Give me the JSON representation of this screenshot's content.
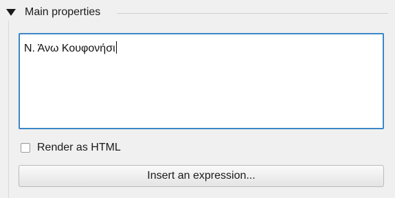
{
  "group": {
    "title": "Main properties"
  },
  "label_text": {
    "value": "Ν. Άνω Κουφονήσι"
  },
  "render_html": {
    "label": "Render as HTML",
    "checked": false
  },
  "insert_expression": {
    "label": "Insert an expression..."
  }
}
